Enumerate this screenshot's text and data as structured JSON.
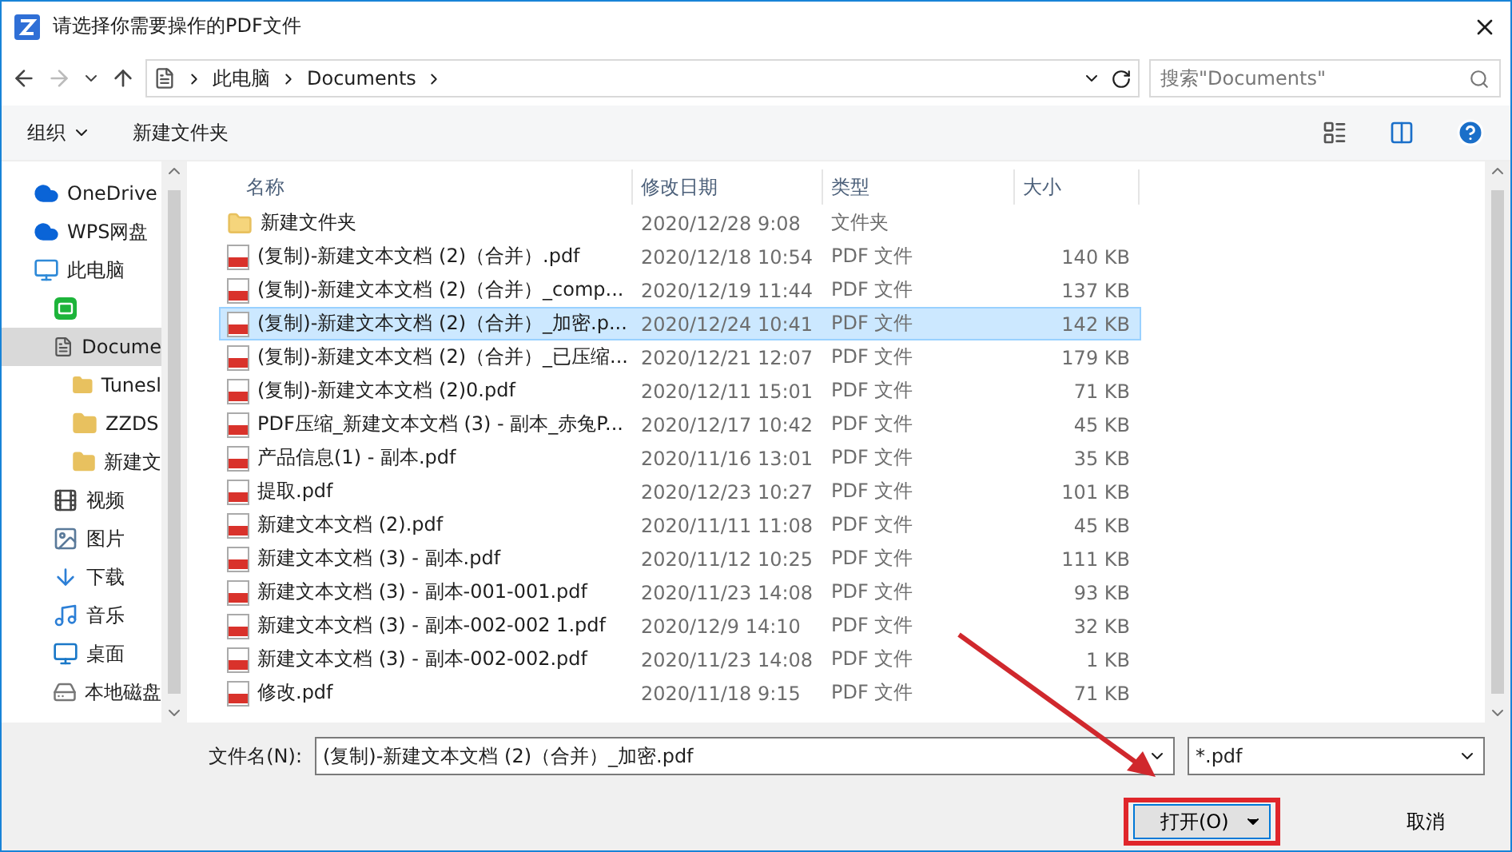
{
  "window": {
    "title": "请选择你需要操作的PDF文件"
  },
  "address": {
    "crumbs": [
      "此电脑",
      "Documents"
    ],
    "search_placeholder": "搜索\"Documents\""
  },
  "toolbar": {
    "organize": "组织",
    "new_folder": "新建文件夹"
  },
  "sidebar": {
    "items": [
      {
        "label": "OneDrive",
        "kind": "cloud",
        "selected": false
      },
      {
        "label": "WPS网盘",
        "kind": "cloud",
        "selected": false
      },
      {
        "label": "此电脑",
        "kind": "monitor",
        "selected": false,
        "children": [
          {
            "kind": "app",
            "selected": false
          },
          {
            "label": "Docume",
            "kind": "document",
            "selected": true,
            "children": [
              {
                "label": "Tunesl",
                "kind": "folder",
                "selected": false
              },
              {
                "label": "ZZDS",
                "kind": "folder",
                "selected": false
              },
              {
                "label": "新建文",
                "kind": "folder",
                "selected": false
              }
            ]
          },
          {
            "label": "视频",
            "kind": "film",
            "selected": false
          },
          {
            "label": "图片",
            "kind": "image",
            "selected": false
          },
          {
            "label": "下载",
            "kind": "download",
            "selected": false
          },
          {
            "label": "音乐",
            "kind": "music",
            "selected": false
          },
          {
            "label": "桌面",
            "kind": "desktop",
            "selected": false
          },
          {
            "label": "本地磁盘",
            "kind": "drive",
            "selected": false
          }
        ]
      }
    ]
  },
  "table": {
    "columns": [
      "名称",
      "修改日期",
      "类型",
      "大小"
    ],
    "rows": [
      {
        "kind": "folder",
        "name": "新建文件夹",
        "date": "2020/12/28 9:08",
        "type": "文件夹",
        "selected": false
      },
      {
        "kind": "pdf",
        "name": "(复制)-新建文本文档 (2)（合并）.pdf",
        "date": "2020/12/18 10:54",
        "type": "PDF 文件",
        "size": "140 KB",
        "selected": false
      },
      {
        "kind": "pdf",
        "name": "(复制)-新建文本文档 (2)（合并）_comp...",
        "date": "2020/12/19 11:44",
        "type": "PDF 文件",
        "size": "137 KB",
        "selected": false
      },
      {
        "kind": "pdf",
        "name": "(复制)-新建文本文档 (2)（合并）_加密.p...",
        "date": "2020/12/24 10:41",
        "type": "PDF 文件",
        "size": "142 KB",
        "selected": true
      },
      {
        "kind": "pdf",
        "name": "(复制)-新建文本文档 (2)（合并）_已压缩...",
        "date": "2020/12/21 12:07",
        "type": "PDF 文件",
        "size": "179 KB",
        "selected": false
      },
      {
        "kind": "pdf",
        "name": "(复制)-新建文本文档 (2)0.pdf",
        "date": "2020/12/11 15:01",
        "type": "PDF 文件",
        "size": "71 KB",
        "selected": false
      },
      {
        "kind": "pdf",
        "name": "PDF压缩_新建文本文档 (3) - 副本_赤兔P...",
        "date": "2020/12/17 10:42",
        "type": "PDF 文件",
        "size": "45 KB",
        "selected": false
      },
      {
        "kind": "pdf",
        "name": "产品信息(1) - 副本.pdf",
        "date": "2020/11/16 13:01",
        "type": "PDF 文件",
        "size": "35 KB",
        "selected": false
      },
      {
        "kind": "pdf",
        "name": "提取.pdf",
        "date": "2020/12/23 10:27",
        "type": "PDF 文件",
        "size": "101 KB",
        "selected": false
      },
      {
        "kind": "pdf",
        "name": "新建文本文档 (2).pdf",
        "date": "2020/11/11 11:08",
        "type": "PDF 文件",
        "size": "45 KB",
        "selected": false
      },
      {
        "kind": "pdf",
        "name": "新建文本文档 (3) - 副本.pdf",
        "date": "2020/11/12 10:25",
        "type": "PDF 文件",
        "size": "111 KB",
        "selected": false
      },
      {
        "kind": "pdf",
        "name": "新建文本文档 (3) - 副本-001-001.pdf",
        "date": "2020/11/23 14:08",
        "type": "PDF 文件",
        "size": "93 KB",
        "selected": false
      },
      {
        "kind": "pdf",
        "name": "新建文本文档 (3) - 副本-002-002 1.pdf",
        "date": "2020/12/9 14:10",
        "type": "PDF 文件",
        "size": "32 KB",
        "selected": false
      },
      {
        "kind": "pdf",
        "name": "新建文本文档 (3) - 副本-002-002.pdf",
        "date": "2020/11/23 14:08",
        "type": "PDF 文件",
        "size": "1 KB",
        "selected": false
      },
      {
        "kind": "pdf",
        "name": "修改.pdf",
        "date": "2020/11/18 9:15",
        "type": "PDF 文件",
        "size": "71 KB",
        "selected": false
      }
    ]
  },
  "footer": {
    "filename_label": "文件名(N):",
    "filename": "(复制)-新建文本文档 (2)（合并）_加密.pdf",
    "filter": "*.pdf",
    "open": "打开(O)",
    "cancel": "取消",
    "open_highlighted": true
  }
}
